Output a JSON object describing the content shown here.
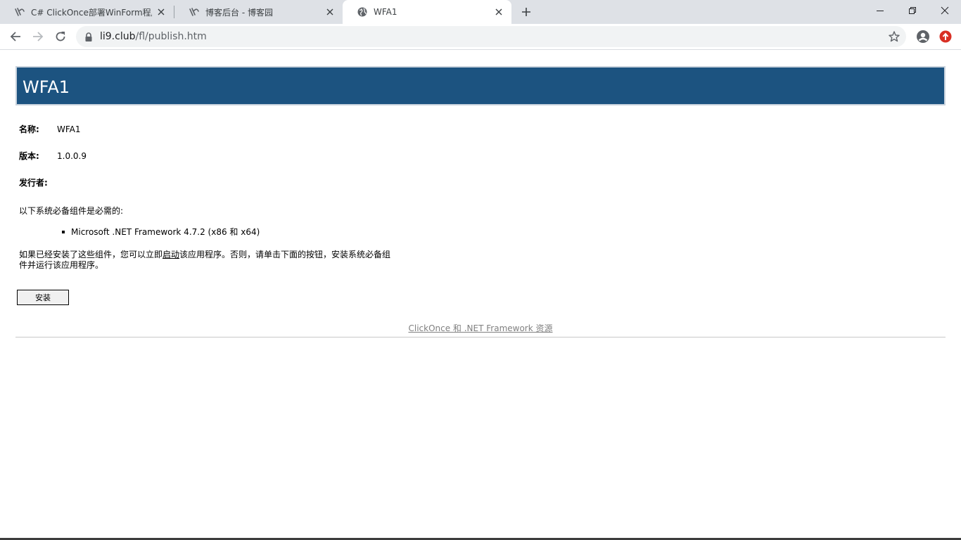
{
  "browser": {
    "tabs": [
      {
        "title": "C# ClickOnce部署WinForm程序",
        "active": false,
        "icon": "cnblogs-icon"
      },
      {
        "title": "博客后台 - 博客园",
        "active": false,
        "icon": "cnblogs-icon"
      },
      {
        "title": "WFA1",
        "active": true,
        "icon": "globe-icon"
      }
    ],
    "url_host": "li9.club",
    "url_path": "/fl/publish.htm"
  },
  "page": {
    "app_title": "WFA1",
    "fields": {
      "name_label": "名称:",
      "name_value": "WFA1",
      "version_label": "版本:",
      "version_value": "1.0.0.9",
      "publisher_label": "发行者:",
      "publisher_value": ""
    },
    "prereq_heading": "以下系统必备组件是必需的:",
    "prerequisites": [
      "Microsoft .NET Framework 4.7.2 (x86 和 x64)"
    ],
    "install_note_before": "如果已经安装了这些组件，您可以立即",
    "install_note_link": "启动",
    "install_note_after": "该应用程序。否则，请单击下面的按钮，安装系统必备组件并运行该应用程序。",
    "install_button": "安装",
    "footer_link": "ClickOnce 和 .NET Framework 资源"
  },
  "colors": {
    "banner": "#1c5380",
    "tabstrip": "#dee1e6",
    "omnibox": "#f1f3f4"
  }
}
